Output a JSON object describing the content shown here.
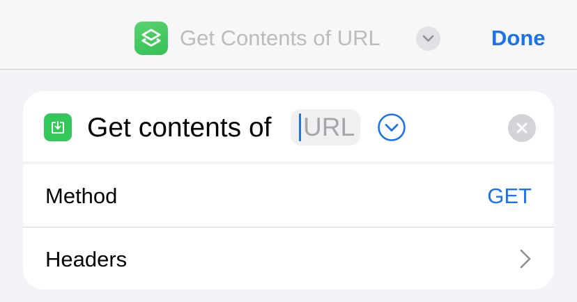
{
  "navbar": {
    "app_icon": "shortcuts-icon",
    "title": "Get Contents of URL",
    "title_menu_icon": "chevron-down-icon",
    "done_label": "Done"
  },
  "action": {
    "icon": "download-tray-icon",
    "text": "Get contents of",
    "url_placeholder": "URL",
    "expand_icon": "chevron-down-circle-icon",
    "remove_icon": "close-icon"
  },
  "params": [
    {
      "label": "Method",
      "value": "GET"
    },
    {
      "label": "Headers",
      "icon": "chevron-right-icon"
    }
  ],
  "colors": {
    "accent": "#1a73e8",
    "app_green": "#34c759",
    "background": "#f2f2f7"
  }
}
